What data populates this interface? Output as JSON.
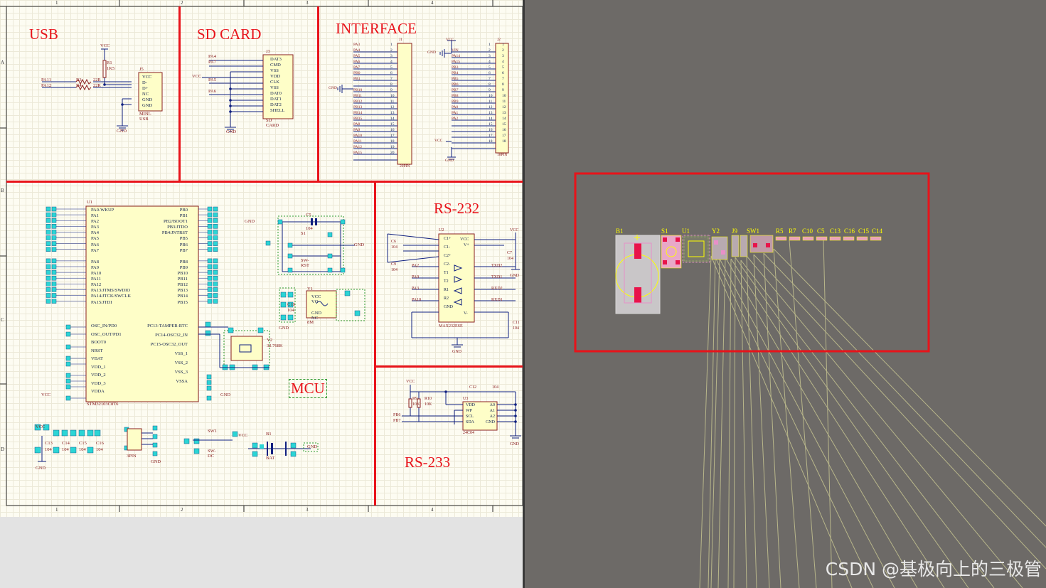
{
  "schematic": {
    "col_marks": [
      "1",
      "2",
      "3",
      "4"
    ],
    "row_marks": [
      "A",
      "B",
      "C",
      "D"
    ],
    "sections": {
      "usb": "USB",
      "sd_card": "SD CARD",
      "interface": "INTERFACE",
      "rs232": "RS-232",
      "mcu": "MCU",
      "rs233": "RS-233"
    },
    "usb": {
      "ref": "J5",
      "name": "MINI-USB",
      "pins": [
        "VCC",
        "D-",
        "D+",
        "NC",
        "GND",
        "GND"
      ],
      "nets": [
        "PA11",
        "PA12"
      ],
      "r3": "R3",
      "r4": "R4",
      "r_val": "22R",
      "r1": "R1",
      "r1_val": "1K5",
      "vcc": "VCC",
      "gnd": "GND"
    },
    "sd": {
      "ref": "J3",
      "name": "SD CARD",
      "pins": [
        "DAT3",
        "CMD",
        "VSS",
        "VDD",
        "CLK",
        "VSS",
        "DAT0",
        "DAT1",
        "DAT2",
        "SHELL"
      ],
      "nets": [
        "PA4",
        "PA7",
        "PA5",
        "PA6"
      ],
      "vcc": "VCC",
      "gnd": "GND"
    },
    "iface": {
      "j1": "J1",
      "j1_name": "20PIN",
      "j1_nets": [
        "PA3",
        "PA4",
        "PA5",
        "PA6",
        "PA7",
        "PB0",
        "PB1",
        "",
        "PB10",
        "PB11",
        "PB12",
        "PB13",
        "PB14",
        "PB15",
        "PA8",
        "PA9",
        "PA10",
        "PA11",
        "PA12",
        "PA15"
      ],
      "j2": "J2",
      "j2_name": "18PIN",
      "j2_nets": [
        "",
        "VIN",
        "PA14",
        "PA15",
        "PB3",
        "PB4",
        "PB5",
        "PB6",
        "PB7",
        "PB8",
        "PB9",
        "PA0",
        "PA1",
        "PA2",
        "",
        "",
        "",
        ""
      ],
      "vcc": "VCC",
      "gnd": "GND"
    },
    "mcu": {
      "ref": "U1",
      "name": "STM32103C8T6",
      "left_pins": [
        "PA0-WKUP",
        "PA1",
        "PA2",
        "PA3",
        "PA4",
        "PA5",
        "PA6",
        "PA7",
        "",
        "PA8",
        "PA9",
        "PA10",
        "PA11",
        "PA12",
        "PA13/JTMS/SWDIO",
        "PA14/JTCK/SWCLK",
        "PA15/JTDI"
      ],
      "left_lower": [
        "OSC_IN/PD0",
        "OSC_OUT/PD1",
        "BOOT0",
        "NRST",
        "VBAT",
        "VDD_1",
        "VDD_2",
        "VDD_3",
        "VDDA"
      ],
      "right_pins": [
        "PB0",
        "PB1",
        "PB2/BOOT1",
        "PB3/JTDO",
        "PB4/JNTRST",
        "PB5",
        "PB6",
        "PB7",
        "",
        "PB8",
        "PB9",
        "PB10",
        "PB11",
        "PB12",
        "PB13",
        "PB14",
        "PB15"
      ],
      "right_lower": [
        "PC13-TAMPER-RTC",
        "PC14-OSC32_IN",
        "PC15-OSC32_OUT",
        "VSS_1",
        "VSS_2",
        "VSS_3",
        "VSSA"
      ],
      "vcc": "VCC",
      "gnd": "GND"
    },
    "misc": {
      "c5": "C5",
      "c5_val": "104",
      "s1": "S1",
      "s1_name": "SW-RST",
      "y1": "Y1",
      "y1_pins": "VCC VO",
      "y1_pins2": "GND NC",
      "y1_val": "8M",
      "c10": "C10",
      "c10_val": "104",
      "y2": "Y2",
      "y2_val": "32.768K",
      "sw1": "SW1",
      "sw1_name": "SW-DC",
      "b1": "B1",
      "b1_name": "BAT",
      "j_pin": "3PIN",
      "caps": [
        "C13",
        "C14",
        "C15",
        "C16"
      ],
      "cap_val": "104",
      "vcc": "VCC",
      "gnd": "GND"
    },
    "rs232": {
      "ref": "U2",
      "name": "MAX232ESE",
      "left_pins": [
        "C1+",
        "C1-",
        "C2+",
        "C2-",
        "T1",
        "T2",
        "R1",
        "R2",
        "GND"
      ],
      "right_pins": [
        "VCC",
        "V+",
        "V-"
      ],
      "nets_left": [
        "PA2",
        "PA9",
        "PA3",
        "PA10"
      ],
      "nets_right": [
        "TXD2",
        "TXD1",
        "RXD2",
        "RXD1"
      ],
      "caps": [
        "C6",
        "C9",
        "C7",
        "C11"
      ],
      "cap_val": "104",
      "vcc": "VCC",
      "gnd": "GND"
    },
    "eeprom": {
      "ref": "U3",
      "name": "24C04",
      "left_pins": [
        "VDD",
        "WP",
        "SCL",
        "SDA"
      ],
      "right_pins": [
        "A0",
        "A1",
        "A2",
        "GND"
      ],
      "r9": "R9",
      "r9_val": "10K",
      "r10": "R10",
      "r10_val": "10K",
      "c12": "C12",
      "c12_val": "104",
      "nets": [
        "PB6",
        "PB7"
      ],
      "vcc": "VCC",
      "gnd": "GND"
    }
  },
  "pcb": {
    "designators": [
      "B1",
      "S1",
      "U1",
      "Y2",
      "J9",
      "SW1",
      "R5",
      "R7",
      "C10",
      "C5",
      "C13",
      "C16",
      "C15",
      "C14"
    ],
    "colors": {
      "board": "#6d6a67",
      "silk": "#ffff00",
      "ratsnest": "#b8b68a",
      "pad": "#e890c8",
      "highlight": "#e8131a"
    }
  },
  "watermark": "CSDN @基极向上的三极管"
}
